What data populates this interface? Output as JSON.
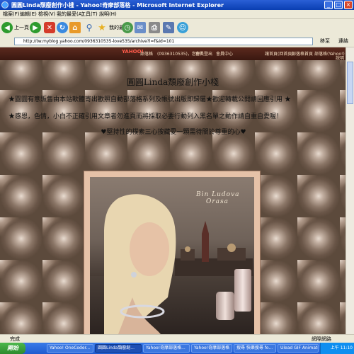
{
  "window": {
    "title": "圓圓Linda頹廢創作小棧 - Yahoo!奇摩部落格 - Microsoft Internet Explorer",
    "minimize": "_",
    "maximize": "□",
    "close": "×"
  },
  "menu": [
    "檔案(F)",
    "編輯(E)",
    "檢視(V)",
    "我的最愛(A)",
    "工具(T)",
    "說明(H)"
  ],
  "toolbar": {
    "back": "上一頁",
    "search": "搜尋",
    "favorites": "我的最愛"
  },
  "address": {
    "url": "http://tw.myblog.yahoo.com/0936310535-love535/archive?l=f&id=101",
    "go": "移至",
    "links": "連結"
  },
  "blognav": {
    "logo": "YAHOO!",
    "item1": "部落格",
    "item2": "(0936310535)，您好！",
    "item3": "會員登出",
    "item4": "會員中心",
    "right1": "讓首頁(回首頁)",
    "right2": "部落格首頁",
    "right3": "部落格(Yahoo!)",
    "right4": "說明"
  },
  "blog": {
    "title": "圓圓Linda頹廢創作小棧",
    "line1": "★圓圓有意販售由本站軟體寄出歡照自動部落格系列及帳號出版即歸屬★歡迎轉載公開請回應引用 ★",
    "line2": "★感恩，色情，小白不正確引用文章者勿進頁而將採取必要行動列入黑名單之動作請自重自愛喔！",
    "line3": "♥堅持性的樸素三心搜藏愛一顆需待關於尊重的心♥"
  },
  "banner": {
    "text1": "Bin Ludova",
    "text2": "Orasa"
  },
  "status": {
    "text": "完成",
    "zone": "網際網路"
  },
  "taskbar": {
    "start": "開始",
    "tasks": [
      "Yahoo! OneCoder...",
      "圓圓Linda頹廢創...",
      "Yahoo!奇摩部落格...",
      "Yahoo!奇摩部落格",
      "搜尋 快樂搜尋 fo...",
      "Ulead GIF Animato..."
    ],
    "clock": "上午 11:10"
  }
}
